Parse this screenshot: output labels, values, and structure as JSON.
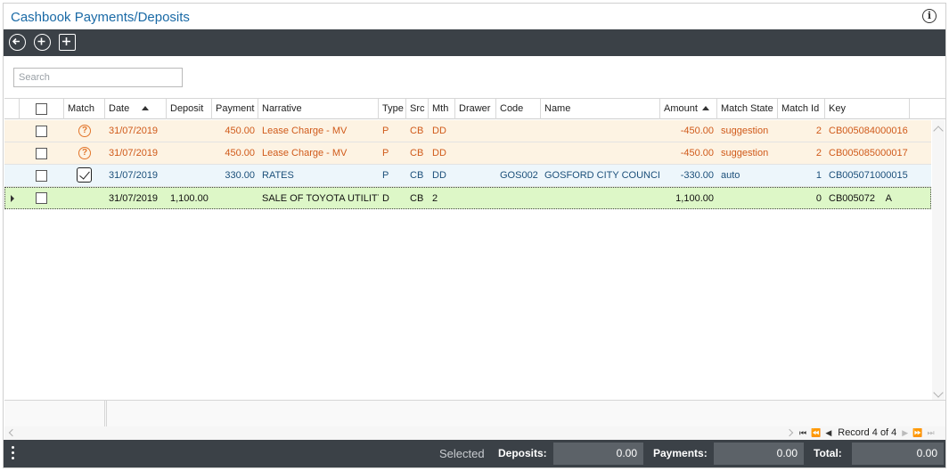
{
  "window": {
    "title": "Cashbook Payments/Deposits",
    "info_icon": "info-icon"
  },
  "toolbar": {
    "icons": [
      "back-arrow-icon",
      "add-circle-icon",
      "add-square-icon"
    ]
  },
  "search": {
    "placeholder": "Search",
    "value": ""
  },
  "grid": {
    "columns": {
      "match": "Match",
      "date": "Date",
      "deposit": "Deposit",
      "payment": "Payment",
      "narrative": "Narrative",
      "type": "Type",
      "src": "Src",
      "mth": "Mth",
      "drawer": "Drawer",
      "code": "Code",
      "name": "Name",
      "amount": "Amount",
      "match_state": "Match State",
      "match_id": "Match Id",
      "key": "Key"
    },
    "sorted_columns": [
      "Date",
      "Amount"
    ],
    "rows": [
      {
        "match_icon": "question-icon",
        "date": "31/07/2019",
        "deposit": "",
        "payment": "450.00",
        "narrative": "Lease Charge - MV",
        "type": "P",
        "src": "CB",
        "mth": "DD",
        "drawer": "",
        "code": "",
        "name": "",
        "amount": "-450.00",
        "match_state": "suggestion",
        "match_id": "2",
        "key": "CB005084000016",
        "status": "suggestion"
      },
      {
        "match_icon": "question-icon",
        "date": "31/07/2019",
        "deposit": "",
        "payment": "450.00",
        "narrative": "Lease Charge - MV",
        "type": "P",
        "src": "CB",
        "mth": "DD",
        "drawer": "",
        "code": "",
        "name": "",
        "amount": "-450.00",
        "match_state": "suggestion",
        "match_id": "2",
        "key": "CB005085000017",
        "status": "suggestion"
      },
      {
        "match_icon": "checkmark-icon",
        "date": "31/07/2019",
        "deposit": "",
        "payment": "330.00",
        "narrative": "RATES",
        "type": "P",
        "src": "CB",
        "mth": "DD",
        "drawer": "",
        "code": "GOS002",
        "name": "GOSFORD CITY COUNCIL",
        "amount": "-330.00",
        "match_state": "auto",
        "match_id": "1",
        "key": "CB005071000015",
        "status": "auto"
      },
      {
        "match_icon": "",
        "date": "31/07/2019",
        "deposit": "1,100.00",
        "payment": "",
        "narrative": "SALE OF TOYOTA UTILITY",
        "type": "D",
        "src": "CB",
        "mth": "2",
        "drawer": "",
        "code": "",
        "name": "",
        "amount": "1,100.00",
        "match_state": "",
        "match_id": "0",
        "key": "CB005072    A",
        "status": "selected"
      }
    ]
  },
  "pager": {
    "label": "Record 4 of 4",
    "icons": [
      "first-page-icon",
      "prev-page-fast-icon",
      "prev-page-icon",
      "next-page-icon",
      "next-page-fast-icon",
      "last-page-icon"
    ]
  },
  "status_bar": {
    "selected_label": "Selected",
    "deposits_label": "Deposits:",
    "deposits_value": "0.00",
    "payments_label": "Payments:",
    "payments_value": "0.00",
    "total_label": "Total:",
    "total_value": "0.00"
  },
  "colors": {
    "title": "#1a6aa6",
    "toolbar_bg": "#3b4147",
    "suggestion_text": "#d05a1a",
    "suggestion_bg": "#fdf3e3",
    "auto_text": "#1b4f7a",
    "auto_bg": "#edf6fb",
    "selected_bg": "#ddf7c7"
  }
}
